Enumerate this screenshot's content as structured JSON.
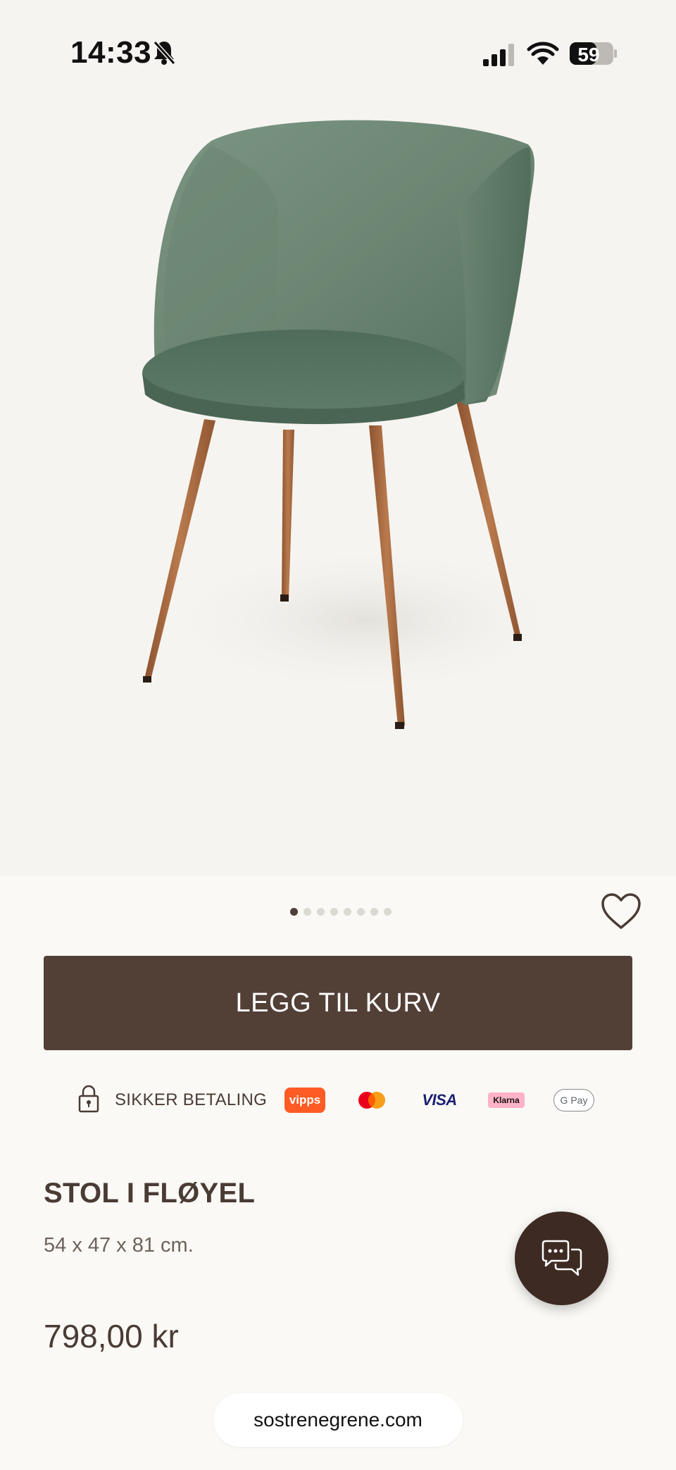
{
  "status_bar": {
    "time": "14:33",
    "battery": "59",
    "icons": [
      "bell-slash-icon",
      "cellular-signal-icon",
      "wifi-icon",
      "battery-icon"
    ]
  },
  "product_image": {
    "subject": "chair-image",
    "upholstery_color": "#6e8a76",
    "leg_color": "#a5663d"
  },
  "carousel": {
    "dot_count": 8,
    "active_index": 0
  },
  "favorite": {
    "icon": "heart-icon"
  },
  "cart": {
    "label": "LEGG TIL KURV",
    "color": "#523f36"
  },
  "payment": {
    "label": "SIKKER BETALING",
    "lock_icon": "lock-icon",
    "methods": [
      {
        "name": "vipps",
        "text": "vipps"
      },
      {
        "name": "mastercard",
        "text": ""
      },
      {
        "name": "visa",
        "text": "VISA"
      },
      {
        "name": "klarna",
        "text": "Klarna"
      },
      {
        "name": "google-pay",
        "text": "G Pay"
      }
    ]
  },
  "product": {
    "title": "STOL I FLØYEL",
    "dimensions": "54 x 47 x 81 cm.",
    "price": "798,00 kr"
  },
  "chat": {
    "icon": "chat-bubbles-icon"
  },
  "browser": {
    "url": "sostrenegrene.com"
  }
}
